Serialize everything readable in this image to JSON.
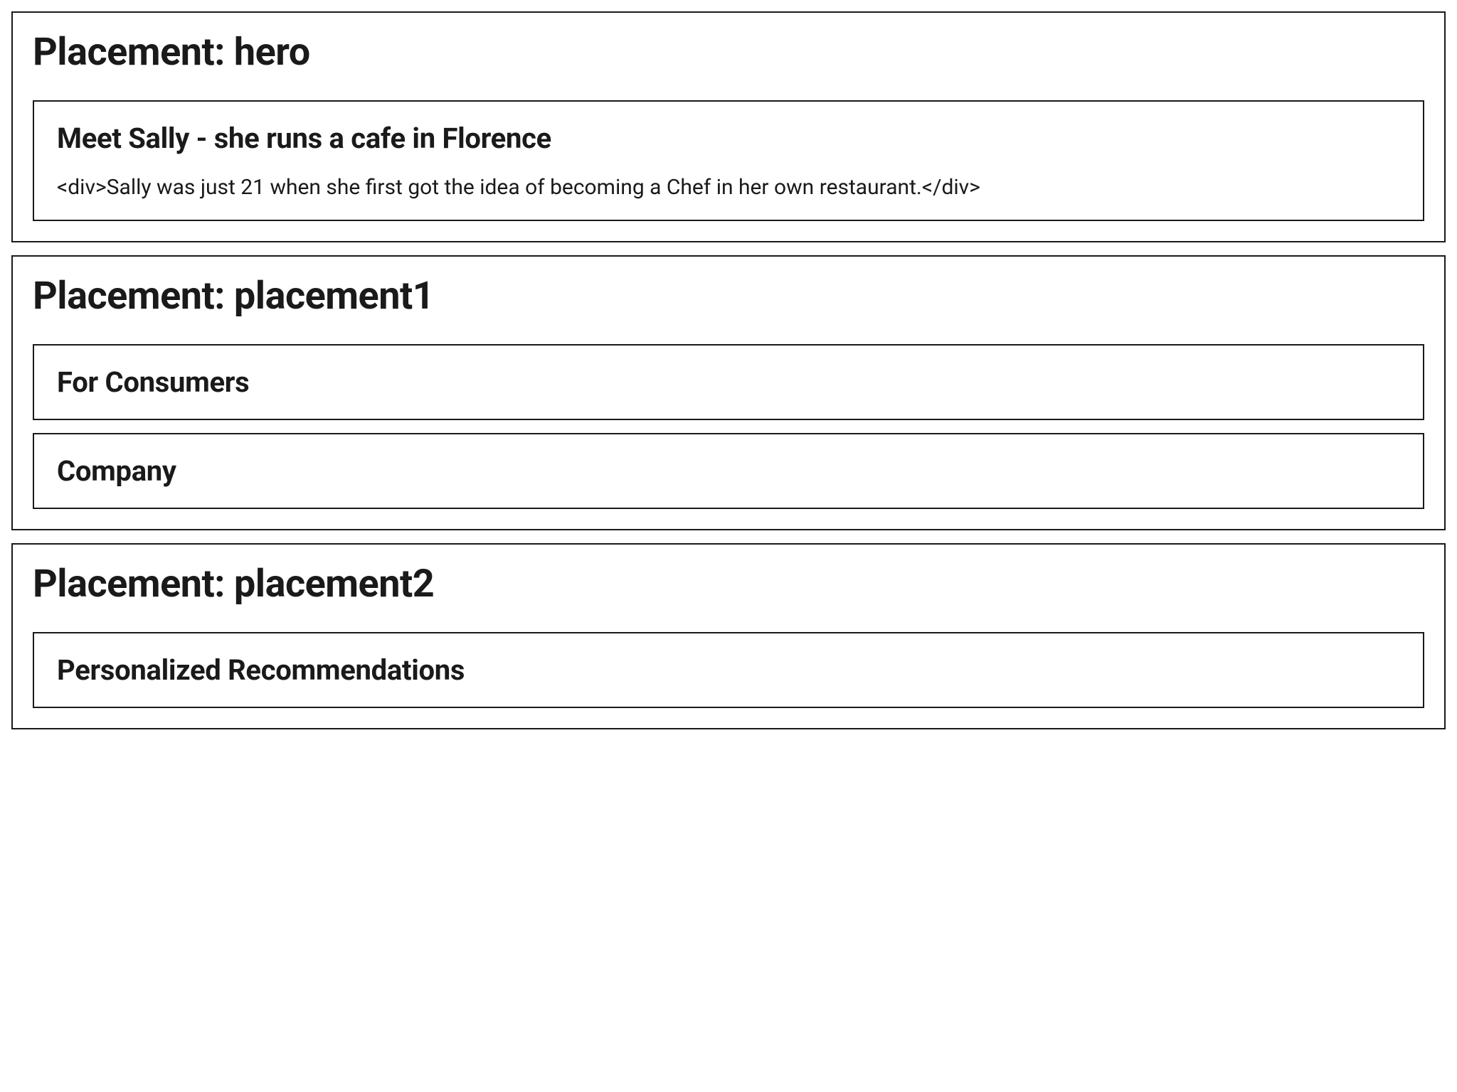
{
  "placements": [
    {
      "title": "Placement: hero",
      "cards": [
        {
          "title": "Meet Sally - she runs a cafe in Florence",
          "body": "<div>Sally was just 21 when she first got the idea of becoming a Chef in her own restaurant.</div>"
        }
      ]
    },
    {
      "title": "Placement: placement1",
      "cards": [
        {
          "title": "For Consumers"
        },
        {
          "title": "Company"
        }
      ]
    },
    {
      "title": "Placement: placement2",
      "cards": [
        {
          "title": "Personalized Recommendations"
        }
      ]
    }
  ]
}
